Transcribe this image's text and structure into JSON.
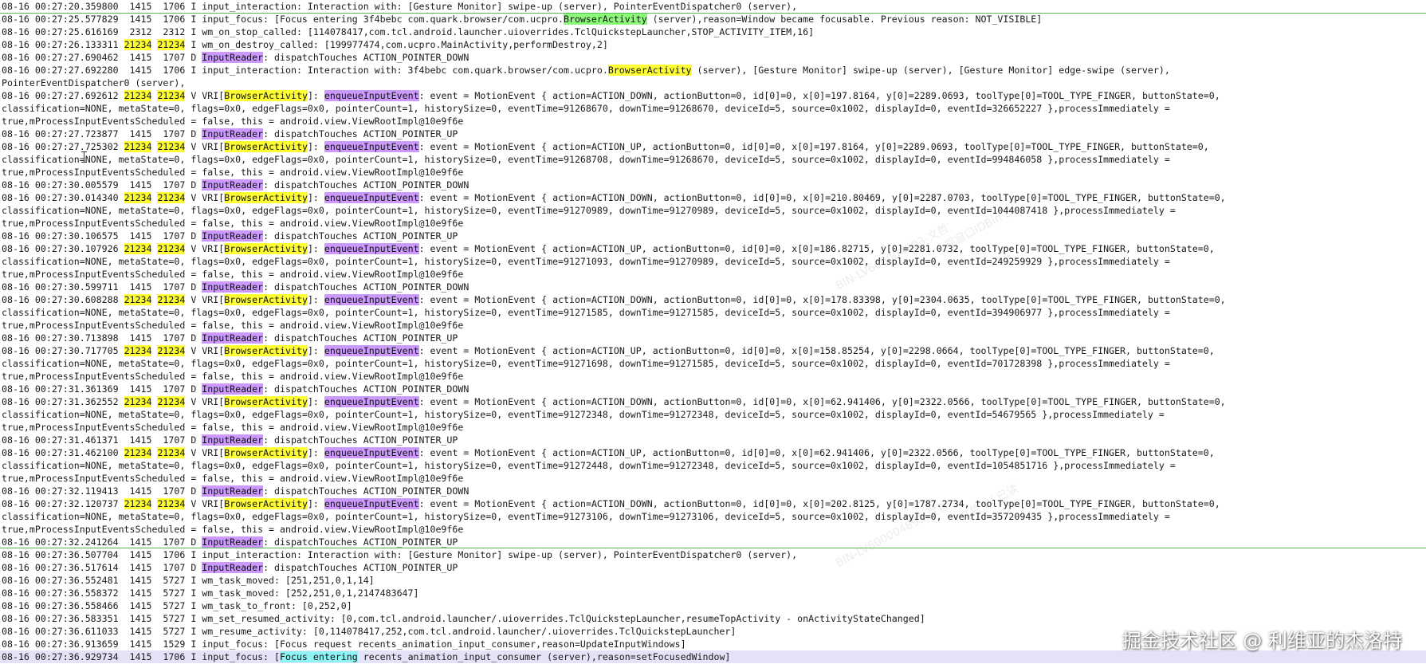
{
  "colors": {
    "package": "#8dfb7a",
    "activity": "#ffff33",
    "pid": "#ffff33",
    "input_reader": "#cc99ff",
    "enqueue": "#cc99ff",
    "focus": "#8ff3f3",
    "selected_row": "#e4e2f6",
    "separator": "#55bb55"
  },
  "lines": [
    [
      "08-16 00:27:20.359800  1415  1706 I input_interaction: Interaction with: [Gesture Monitor] swipe-up (server), PointerEventDispatcher0 (server),"
    ],
    [
      "08-16 00:27:25.577829  1415  1706 I input_focus: [Focus entering 3f4bebc com.quark.browser/com.ucpro.",
      [
        "BrowserActivity",
        "green"
      ],
      " (server),reason=Window became focusable. Previous reason: NOT_VISIBLE]"
    ],
    [
      "08-16 00:27:25.616169  2312  2312 I wm_on_stop_called: [114078417,com.tcl.android.launcher.uioverrides.TclQuickstepLauncher,STOP_ACTIVITY_ITEM,16]"
    ],
    [
      "08-16 00:27:26.133311 ",
      [
        "21234",
        "yellow"
      ],
      " ",
      [
        "21234",
        "yellow"
      ],
      " I wm_on_destroy_called: [199977474,com.ucpro.MainActivity,performDestroy,2]"
    ],
    [
      "08-16 00:27:27.690462  1415  1707 D ",
      [
        "InputReader",
        "violet"
      ],
      ": dispatchTouches ACTION_POINTER_DOWN"
    ],
    [
      "08-16 00:27:27.692280  1415  1706 I input_interaction: Interaction with: 3f4bebc com.quark.browser/com.ucpro.",
      [
        "BrowserActivity",
        "yellow"
      ],
      " (server), [Gesture Monitor] swipe-up (server), [Gesture Monitor] edge-swipe (server),"
    ],
    [
      "PointerEventDispatcher0 (server),"
    ],
    [
      "08-16 00:27:27.692612 ",
      [
        "21234",
        "yellow"
      ],
      " ",
      [
        "21234",
        "yellow"
      ],
      " V VRI[",
      [
        "BrowserActivity",
        "yellow"
      ],
      "]: ",
      [
        "enqueueInputEvent",
        "violet"
      ],
      ": event = MotionEvent { action=ACTION_DOWN, actionButton=0, id[0]=0, x[0]=197.8164, y[0]=2289.0693, toolType[0]=TOOL_TYPE_FINGER, buttonState=0,"
    ],
    [
      "classification=NONE, metaState=0, flags=0x0, edgeFlags=0x0, pointerCount=1, historySize=0, eventTime=91268670, downTime=91268670, deviceId=5, source=0x1002, displayId=0, eventId=326652227 },processImmediately ="
    ],
    [
      "true,mProcessInputEventsScheduled = false, this = android.view.ViewRootImpl@10e9f6e"
    ],
    [
      "08-16 00:27:27.723877  1415  1707 D ",
      [
        "InputReader",
        "violet"
      ],
      ": dispatchTouches ACTION_POINTER_UP"
    ],
    [
      "08-16 00:27:27.725302 ",
      [
        "21234",
        "yellow"
      ],
      " ",
      [
        "21234",
        "yellow"
      ],
      " V VRI[",
      [
        "BrowserActivity",
        "yellow"
      ],
      "]: ",
      [
        "enqueueInputEvent",
        "violet"
      ],
      ": event = MotionEvent { action=ACTION_UP, actionButton=0, id[0]=0, x[0]=197.8164, y[0]=2289.0693, toolType[0]=TOOL_TYPE_FINGER, buttonState=0,"
    ],
    [
      "classification=NONE, metaState=0, flags=0x0, edgeFlags=0x0, pointerCount=1, historySize=0, eventTime=91268708, downTime=91268670, deviceId=5, source=0x1002, displayId=0, eventId=994846058 },processImmediately ="
    ],
    [
      "true,mProcessInputEventsScheduled = false, this = android.view.ViewRootImpl@10e9f6e"
    ],
    [
      "08-16 00:27:30.005579  1415  1707 D ",
      [
        "InputReader",
        "violet"
      ],
      ": dispatchTouches ACTION_POINTER_DOWN"
    ],
    [
      "08-16 00:27:30.014340 ",
      [
        "21234",
        "yellow"
      ],
      " ",
      [
        "21234",
        "yellow"
      ],
      " V VRI[",
      [
        "BrowserActivity",
        "yellow"
      ],
      "]: ",
      [
        "enqueueInputEvent",
        "violet"
      ],
      ": event = MotionEvent { action=ACTION_DOWN, actionButton=0, id[0]=0, x[0]=210.80469, y[0]=2287.0703, toolType[0]=TOOL_TYPE_FINGER, buttonState=0,"
    ],
    [
      "classification=NONE, metaState=0, flags=0x0, edgeFlags=0x0, pointerCount=1, historySize=0, eventTime=91270989, downTime=91270989, deviceId=5, source=0x1002, displayId=0, eventId=1044087418 },processImmediately ="
    ],
    [
      "true,mProcessInputEventsScheduled = false, this = android.view.ViewRootImpl@10e9f6e"
    ],
    [
      "08-16 00:27:30.106575  1415  1707 D ",
      [
        "InputReader",
        "violet"
      ],
      ": dispatchTouches ACTION_POINTER_UP"
    ],
    [
      "08-16 00:27:30.107926 ",
      [
        "21234",
        "yellow"
      ],
      " ",
      [
        "21234",
        "yellow"
      ],
      " V VRI[",
      [
        "BrowserActivity",
        "yellow"
      ],
      "]: ",
      [
        "enqueueInputEvent",
        "violet"
      ],
      ": event = MotionEvent { action=ACTION_UP, actionButton=0, id[0]=0, x[0]=186.82715, y[0]=2281.0732, toolType[0]=TOOL_TYPE_FINGER, buttonState=0,"
    ],
    [
      "classification=NONE, metaState=0, flags=0x0, edgeFlags=0x0, pointerCount=1, historySize=0, eventTime=91271093, downTime=91270989, deviceId=5, source=0x1002, displayId=0, eventId=249259929 },processImmediately ="
    ],
    [
      "true,mProcessInputEventsScheduled = false, this = android.view.ViewRootImpl@10e9f6e"
    ],
    [
      "08-16 00:27:30.599711  1415  1707 D ",
      [
        "InputReader",
        "violet"
      ],
      ": dispatchTouches ACTION_POINTER_DOWN"
    ],
    [
      "08-16 00:27:30.608288 ",
      [
        "21234",
        "yellow"
      ],
      " ",
      [
        "21234",
        "yellow"
      ],
      " V VRI[",
      [
        "BrowserActivity",
        "yellow"
      ],
      "]: ",
      [
        "enqueueInputEvent",
        "violet"
      ],
      ": event = MotionEvent { action=ACTION_DOWN, actionButton=0, id[0]=0, x[0]=178.83398, y[0]=2304.0635, toolType[0]=TOOL_TYPE_FINGER, buttonState=0,"
    ],
    [
      "classification=NONE, metaState=0, flags=0x0, edgeFlags=0x0, pointerCount=1, historySize=0, eventTime=91271585, downTime=91271585, deviceId=5, source=0x1002, displayId=0, eventId=394906977 },processImmediately ="
    ],
    [
      "true,mProcessInputEventsScheduled = false, this = android.view.ViewRootImpl@10e9f6e"
    ],
    [
      "08-16 00:27:30.713898  1415  1707 D ",
      [
        "InputReader",
        "violet"
      ],
      ": dispatchTouches ACTION_POINTER_UP"
    ],
    [
      "08-16 00:27:30.717705 ",
      [
        "21234",
        "yellow"
      ],
      " ",
      [
        "21234",
        "yellow"
      ],
      " V VRI[",
      [
        "BrowserActivity",
        "yellow"
      ],
      "]: ",
      [
        "enqueueInputEvent",
        "violet"
      ],
      ": event = MotionEvent { action=ACTION_UP, actionButton=0, id[0]=0, x[0]=158.85254, y[0]=2298.0664, toolType[0]=TOOL_TYPE_FINGER, buttonState=0,"
    ],
    [
      "classification=NONE, metaState=0, flags=0x0, edgeFlags=0x0, pointerCount=1, historySize=0, eventTime=91271698, downTime=91271585, deviceId=5, source=0x1002, displayId=0, eventId=701728398 },processImmediately ="
    ],
    [
      "true,mProcessInputEventsScheduled = false, this = android.view.ViewRootImpl@10e9f6e"
    ],
    [
      "08-16 00:27:31.361369  1415  1707 D ",
      [
        "InputReader",
        "violet"
      ],
      ": dispatchTouches ACTION_POINTER_DOWN"
    ],
    [
      "08-16 00:27:31.362552 ",
      [
        "21234",
        "yellow"
      ],
      " ",
      [
        "21234",
        "yellow"
      ],
      " V VRI[",
      [
        "BrowserActivity",
        "yellow"
      ],
      "]: ",
      [
        "enqueueInputEvent",
        "violet"
      ],
      ": event = MotionEvent { action=ACTION_DOWN, actionButton=0, id[0]=0, x[0]=62.941406, y[0]=2322.0566, toolType[0]=TOOL_TYPE_FINGER, buttonState=0,"
    ],
    [
      "classification=NONE, metaState=0, flags=0x0, edgeFlags=0x0, pointerCount=1, historySize=0, eventTime=91272348, downTime=91272348, deviceId=5, source=0x1002, displayId=0, eventId=54679565 },processImmediately ="
    ],
    [
      "true,mProcessInputEventsScheduled = false, this = android.view.ViewRootImpl@10e9f6e"
    ],
    [
      "08-16 00:27:31.461371  1415  1707 D ",
      [
        "InputReader",
        "violet"
      ],
      ": dispatchTouches ACTION_POINTER_UP"
    ],
    [
      "08-16 00:27:31.462100 ",
      [
        "21234",
        "yellow"
      ],
      " ",
      [
        "21234",
        "yellow"
      ],
      " V VRI[",
      [
        "BrowserActivity",
        "yellow"
      ],
      "]: ",
      [
        "enqueueInputEvent",
        "violet"
      ],
      ": event = MotionEvent { action=ACTION_UP, actionButton=0, id[0]=0, x[0]=62.941406, y[0]=2322.0566, toolType[0]=TOOL_TYPE_FINGER, buttonState=0,"
    ],
    [
      "classification=NONE, metaState=0, flags=0x0, edgeFlags=0x0, pointerCount=1, historySize=0, eventTime=91272448, downTime=91272348, deviceId=5, source=0x1002, displayId=0, eventId=1054851716 },processImmediately ="
    ],
    [
      "true,mProcessInputEventsScheduled = false, this = android.view.ViewRootImpl@10e9f6e"
    ],
    [
      "08-16 00:27:32.119413  1415  1707 D ",
      [
        "InputReader",
        "violet"
      ],
      ": dispatchTouches ACTION_POINTER_DOWN"
    ],
    [
      "08-16 00:27:32.120737 ",
      [
        "21234",
        "yellow"
      ],
      " ",
      [
        "21234",
        "yellow"
      ],
      " V VRI[",
      [
        "BrowserActivity",
        "yellow"
      ],
      "]: ",
      [
        "enqueueInputEvent",
        "violet"
      ],
      ": event = MotionEvent { action=ACTION_DOWN, actionButton=0, id[0]=0, x[0]=202.8125, y[0]=1787.2734, toolType[0]=TOOL_TYPE_FINGER, buttonState=0,"
    ],
    [
      "classification=NONE, metaState=0, flags=0x0, edgeFlags=0x0, pointerCount=1, historySize=0, eventTime=91273106, downTime=91273106, deviceId=5, source=0x1002, displayId=0, eventId=357209435 },processImmediately ="
    ],
    [
      "true,mProcessInputEventsScheduled = false, this = android.view.ViewRootImpl@10e9f6e"
    ],
    [
      "08-16 00:27:32.241264  1415  1707 D ",
      [
        "InputReader",
        "violet"
      ],
      ": dispatchTouches ACTION_POINTER_UP"
    ],
    [
      "08-16 00:27:36.507704  1415  1706 I input_interaction: Interaction with: [Gesture Monitor] swipe-up (server), PointerEventDispatcher0 (server),"
    ],
    [
      "08-16 00:27:36.517614  1415  1707 D ",
      [
        "InputReader",
        "violet"
      ],
      ": dispatchTouches ACTION_POINTER_UP"
    ],
    [
      "08-16 00:27:36.552481  1415  5727 I wm_task_moved: [251,251,0,1,14]"
    ],
    [
      "08-16 00:27:36.558372  1415  5727 I wm_task_moved: [252,251,0,1,2147483647]"
    ],
    [
      "08-16 00:27:36.558466  1415  5727 I wm_task_to_front: [0,252,0]"
    ],
    [
      "08-16 00:27:36.583351  1415  5727 I wm_set_resumed_activity: [0,com.tcl.android.launcher/.uioverrides.TclQuickstepLauncher,resumeTopActivity - onActivityStateChanged]"
    ],
    [
      "08-16 00:27:36.611033  1415  5727 I wm_resume_activity: [0,114078417,252,com.tcl.android.launcher/.uioverrides.TclQuickstepLauncher]"
    ],
    [
      "08-16 00:27:36.913659  1415  1529 I input_focus: [Focus request recents_animation_input_consumer,reason=UpdateInputWindows]"
    ],
    [
      "08-16 00:27:36.929734  1415  1706 I input_focus: [",
      [
        "Focus entering",
        "cyan"
      ],
      " recents_animation_input_consumer (server),reason=setFocusedWindow]"
    ]
  ],
  "watermarks": [
    "BIN-LV600004893-文哲",
    "视窗口IDBin LV",
    "BIN-LV600004893-文哲",
    "文哲 LV 已读"
  ],
  "brand": "掘金技术社区 @ 利维亚的杰洛特"
}
